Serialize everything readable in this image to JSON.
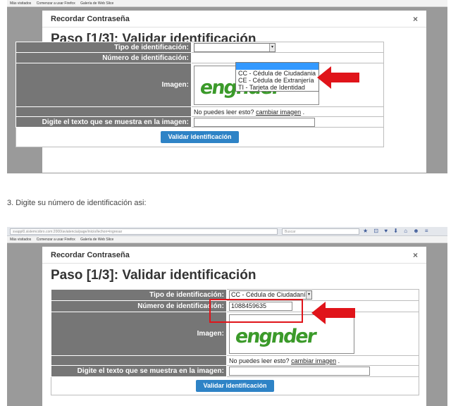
{
  "browser": {
    "bookmarks": [
      "Más visitados",
      "Comenzar a usar Firefox",
      "Galería de Web Slice"
    ],
    "url": "svappl0.sistemcobro.com:2000/aviatencia/page/inicio/lechon=ingresar",
    "search_placeholder": "Buscar",
    "toolbar_icons": "★ ⊡ ♥ ⬇ ⌂ ☻ ≡"
  },
  "modal": {
    "header": "Recordar Contraseña",
    "close": "×",
    "title": "Paso [1/3]: Validar identificación",
    "labels": {
      "tipo": "Tipo de identificación:",
      "numero": "Número de identificación:",
      "imagen": "Imagen:",
      "digite": "Digite el texto que se muestra en la imagen:"
    },
    "captcha_text": "engnder",
    "cant_read": "No puedes leer esto?",
    "change_image": "cambiar imagen",
    "change_image_suffix": ".",
    "submit": "Validar identificación"
  },
  "screenshot1": {
    "dropdown_options": [
      "CC - Cédula de Ciudadania",
      "CE - Cédula de Extranjería",
      "TI - Tarjeta de Identidad"
    ]
  },
  "step3_text": "3. Digite su número de identificación asi:",
  "screenshot2": {
    "selected_tipo": "CC - Cédula de Ciudadanía",
    "numero_value": "1088459635"
  },
  "colors": {
    "annotation": "#e0141a",
    "button": "#2e83c6",
    "captcha": "#3b9a2a"
  }
}
